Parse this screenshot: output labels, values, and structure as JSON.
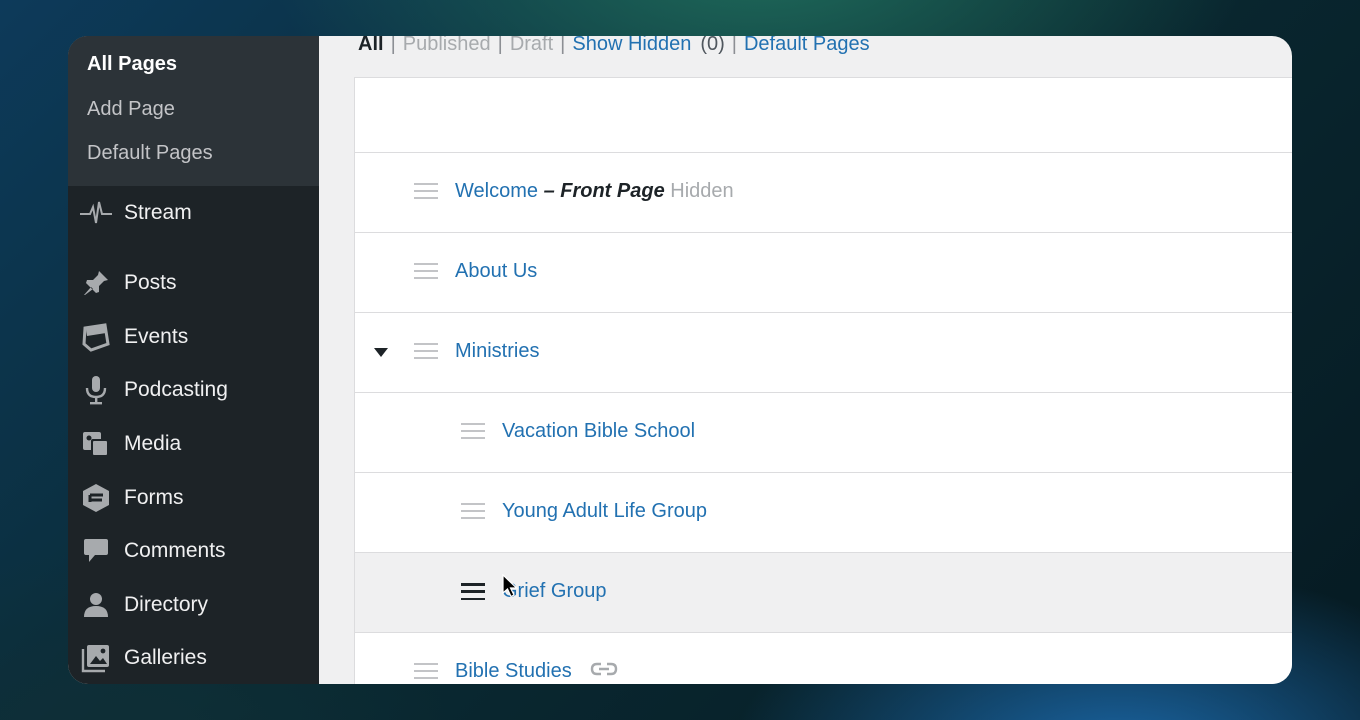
{
  "sidebar": {
    "submenu": [
      {
        "label": "All Pages",
        "current": true
      },
      {
        "label": "Add Page"
      },
      {
        "label": "Default Pages"
      }
    ],
    "menu": [
      {
        "label": "Stream",
        "icon": "pulse-icon"
      },
      {
        "label": "Posts",
        "icon": "pushpin-icon"
      },
      {
        "label": "Events",
        "icon": "calendar-icon"
      },
      {
        "label": "Podcasting",
        "icon": "microphone-icon"
      },
      {
        "label": "Media",
        "icon": "media-icon"
      },
      {
        "label": "Forms",
        "icon": "forms-icon"
      },
      {
        "label": "Comments",
        "icon": "comment-icon"
      },
      {
        "label": "Directory",
        "icon": "person-icon"
      },
      {
        "label": "Galleries",
        "icon": "gallery-icon"
      }
    ]
  },
  "filters": {
    "all": "All",
    "published": "Published",
    "draft": "Draft",
    "show_hidden": "Show Hidden",
    "hidden_count": "(0)",
    "default_pages": "Default Pages",
    "separator": "|"
  },
  "pages": [
    {
      "title": "Welcome",
      "state": "– Front Page",
      "status": "Hidden"
    },
    {
      "title": "About Us"
    },
    {
      "title": "Ministries",
      "expanded": true
    },
    {
      "title": "Vacation Bible School"
    },
    {
      "title": "Young Adult Life Group"
    },
    {
      "title": "Grief Group",
      "dragging": true
    },
    {
      "title": "Bible Studies",
      "icon": "link-icon"
    }
  ],
  "colors": {
    "sidebar": "#1d2327",
    "submenu": "#2c3338",
    "link": "#2271b1",
    "muted": "#a7aaad"
  }
}
